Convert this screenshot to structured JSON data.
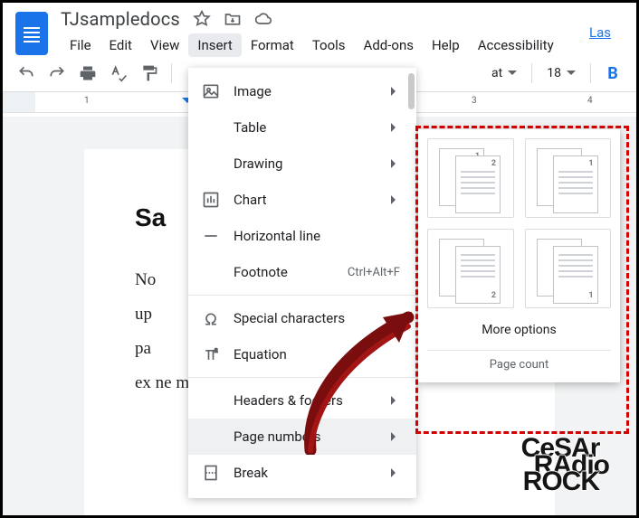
{
  "doc": {
    "title": "TJsampledocs"
  },
  "menubar": {
    "file": "File",
    "edit": "Edit",
    "view": "View",
    "insert": "Insert",
    "format": "Format",
    "tools": "Tools",
    "addons": "Add-ons",
    "help": "Help",
    "accessibility": "Accessibility",
    "last": "Las"
  },
  "toolbar": {
    "font_label": "at",
    "font_size": "18",
    "bold": "B"
  },
  "ruler": {
    "ticks": [
      "1",
      "3",
      "4"
    ]
  },
  "page": {
    "heading": "Sa",
    "body": "No\nup\npa\nex                                              ne m       o   len"
  },
  "insert_menu": {
    "image": "Image",
    "table": "Table",
    "drawing": "Drawing",
    "chart": "Chart",
    "hline": "Horizontal line",
    "footnote": "Footnote",
    "footnote_kbd": "Ctrl+Alt+F",
    "special": "Special characters",
    "equation": "Equation",
    "headers": "Headers & footers",
    "pagenumbers": "Page numbers",
    "break": "Break"
  },
  "submenu": {
    "more": "More options",
    "pagecount": "Page count"
  },
  "watermark": {
    "l1": "CeSAr",
    "l2": "RAdio",
    "l3": "ROCK"
  }
}
